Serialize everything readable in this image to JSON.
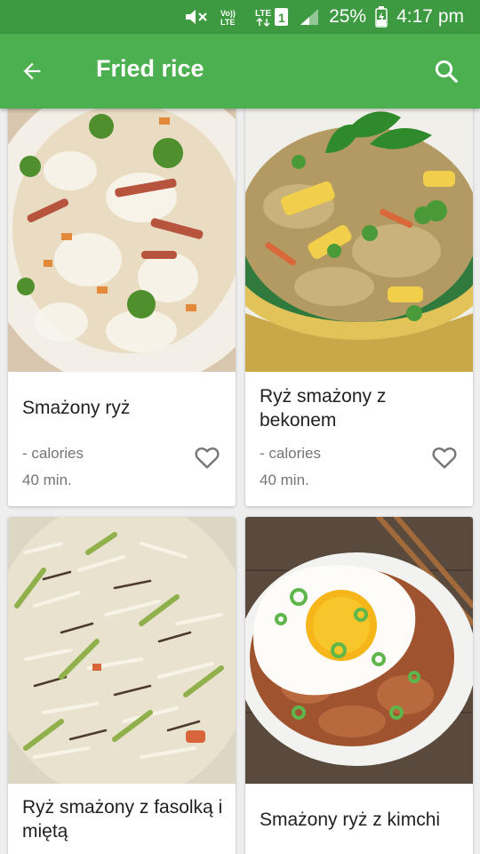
{
  "status_bar": {
    "battery": "25%",
    "time": "4:17 pm",
    "lte_label": "LTE",
    "volte_label": "Vo)) LTE",
    "sim_slot": "1"
  },
  "app_bar": {
    "title": "Fried rice",
    "back_icon": "arrow-back-icon",
    "search_icon": "search-icon"
  },
  "recipes": [
    {
      "name": "Smażony ryż",
      "calories": "- calories",
      "time": "40 min."
    },
    {
      "name": "Ryż smażony z bekonem",
      "calories": "- calories",
      "time": "40 min."
    },
    {
      "name": "Ryż smażony z fasolką i miętą"
    },
    {
      "name": "Smażony ryż z kimchi"
    }
  ],
  "colors": {
    "status_bar": "#3d9a41",
    "app_bar": "#4caf50",
    "background": "#eeeeee"
  }
}
